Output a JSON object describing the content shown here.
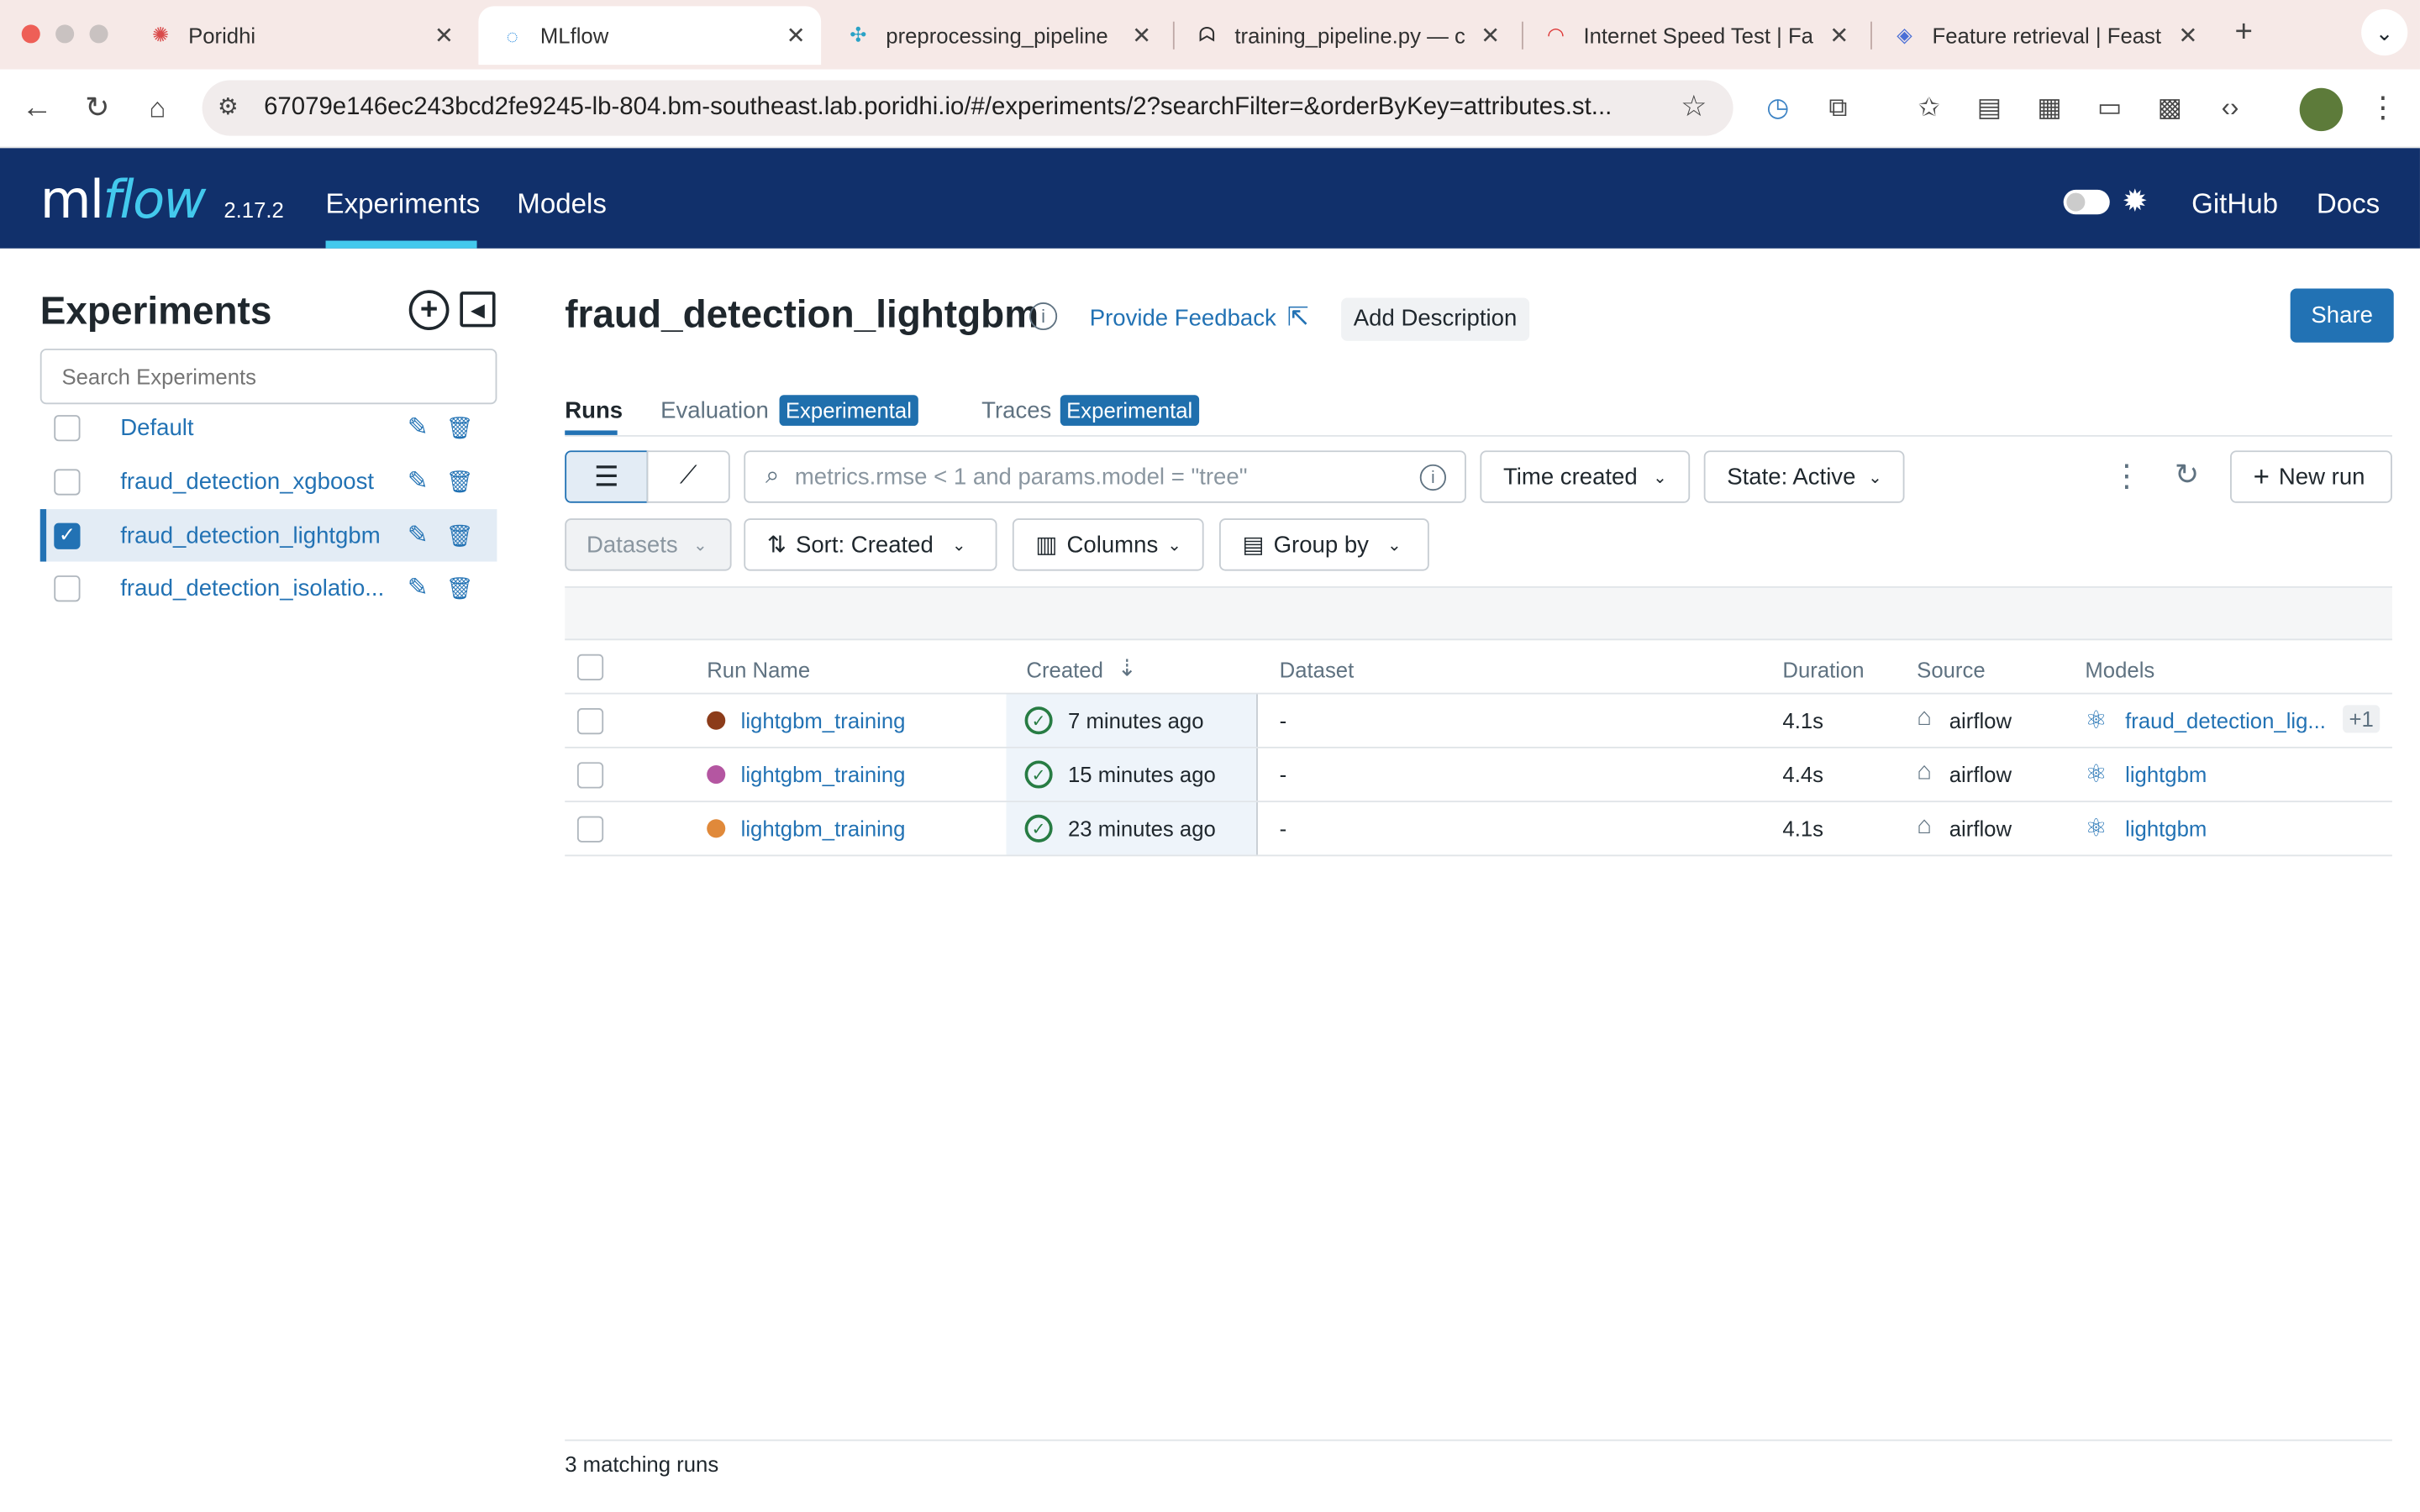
{
  "browser": {
    "tabs": [
      {
        "title": "Poridhi",
        "icon": "poridhi-icon"
      },
      {
        "title": "MLflow",
        "icon": "mlflow-icon",
        "active": true
      },
      {
        "title": "preprocessing_pipeline",
        "icon": "airflow-icon"
      },
      {
        "title": "training_pipeline.py — c",
        "icon": "code-icon"
      },
      {
        "title": "Internet Speed Test | Fa",
        "icon": "speed-icon"
      },
      {
        "title": "Feature retrieval | Feast",
        "icon": "feast-icon"
      }
    ],
    "url": "67079e146ec243bcd2fe9245-lb-804.bm-southeast.lab.poridhi.io/#/experiments/2?searchFilter=&orderByKey=attributes.st..."
  },
  "header": {
    "logo_ml": "ml",
    "logo_flow": "flow",
    "version": "2.17.2",
    "nav": [
      "Experiments",
      "Models"
    ],
    "right": [
      "GitHub",
      "Docs"
    ]
  },
  "sidebar": {
    "title": "Experiments",
    "search_placeholder": "Search Experiments",
    "items": [
      {
        "name": "Default",
        "checked": false
      },
      {
        "name": "fraud_detection_xgboost",
        "checked": false
      },
      {
        "name": "fraud_detection_lightgbm",
        "checked": true
      },
      {
        "name": "fraud_detection_isolatio...",
        "checked": false
      }
    ]
  },
  "main": {
    "title": "fraud_detection_lightgbm",
    "feedback": "Provide Feedback",
    "add_description": "Add Description",
    "share": "Share",
    "tabs": [
      "Runs",
      "Evaluation",
      "Traces"
    ],
    "experimental_badge": "Experimental",
    "search_placeholder": "metrics.rmse < 1 and params.model = \"tree\"",
    "time_created": "Time created",
    "state": "State: Active",
    "new_run": "New run",
    "datasets": "Datasets",
    "sort": "Sort: Created",
    "columns": "Columns",
    "group_by": "Group by",
    "table": {
      "headers": [
        "Run Name",
        "Created",
        "Dataset",
        "Duration",
        "Source",
        "Models"
      ],
      "rows": [
        {
          "name": "lightgbm_training",
          "color": "#8c3c1a",
          "created": "7 minutes ago",
          "dataset": "-",
          "duration": "4.1s",
          "source": "airflow",
          "model": "fraud_detection_lig...",
          "extra": "+1"
        },
        {
          "name": "lightgbm_training",
          "color": "#b456a1",
          "created": "15 minutes ago",
          "dataset": "-",
          "duration": "4.4s",
          "source": "airflow",
          "model": "lightgbm",
          "extra": ""
        },
        {
          "name": "lightgbm_training",
          "color": "#e0893a",
          "created": "23 minutes ago",
          "dataset": "-",
          "duration": "4.1s",
          "source": "airflow",
          "model": "lightgbm",
          "extra": ""
        }
      ]
    },
    "footer": "3 matching runs"
  }
}
